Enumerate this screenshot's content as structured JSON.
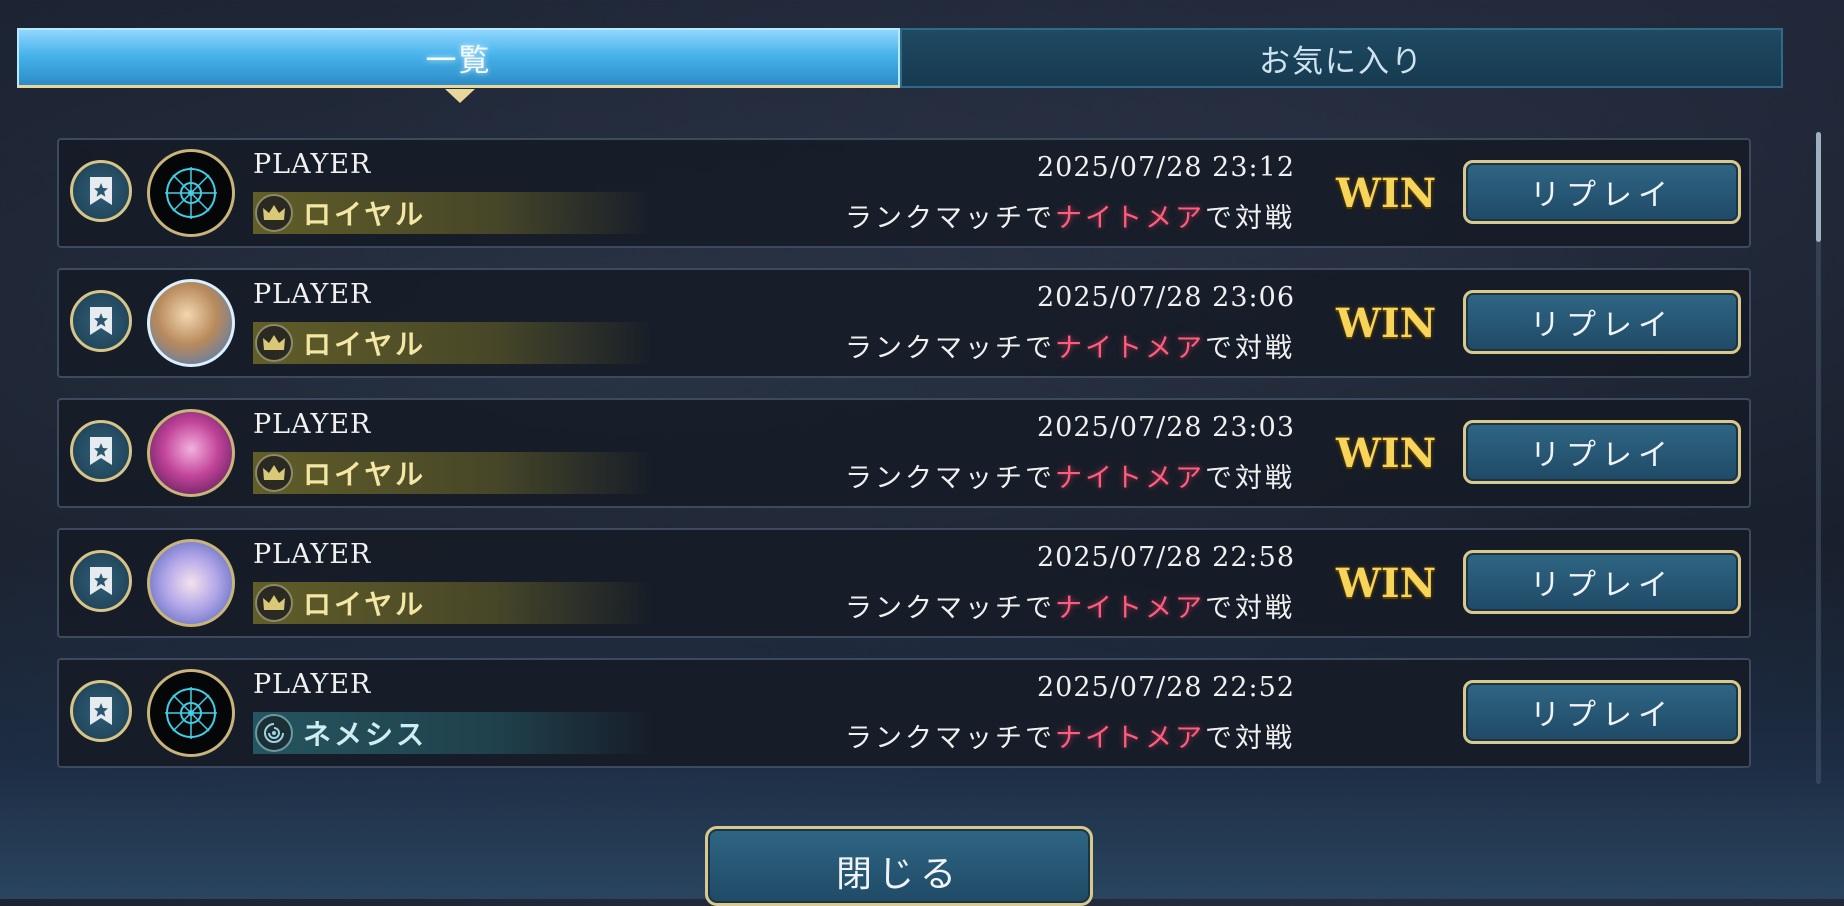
{
  "tabs": [
    {
      "label": "一覧",
      "active": true
    },
    {
      "label": "お気に入り",
      "active": false
    }
  ],
  "entries": [
    {
      "player": "PLAYER",
      "class_name": "ロイヤル",
      "class_icon": "crown-icon",
      "avatar": "emblem",
      "datetime": "2025/07/28 23:12",
      "desc_prefix": "ランクマッチで",
      "desc_highlight": "ナイトメア",
      "desc_suffix": "で対戦",
      "result": "WIN",
      "replay_label": "リプレイ"
    },
    {
      "player": "PLAYER",
      "class_name": "ロイヤル",
      "class_icon": "crown-icon",
      "avatar": "portrait-a",
      "datetime": "2025/07/28 23:06",
      "desc_prefix": "ランクマッチで",
      "desc_highlight": "ナイトメア",
      "desc_suffix": "で対戦",
      "result": "WIN",
      "replay_label": "リプレイ"
    },
    {
      "player": "PLAYER",
      "class_name": "ロイヤル",
      "class_icon": "crown-icon",
      "avatar": "portrait-b",
      "datetime": "2025/07/28 23:03",
      "desc_prefix": "ランクマッチで",
      "desc_highlight": "ナイトメア",
      "desc_suffix": "で対戦",
      "result": "WIN",
      "replay_label": "リプレイ"
    },
    {
      "player": "PLAYER",
      "class_name": "ロイヤル",
      "class_icon": "crown-icon",
      "avatar": "portrait-c",
      "datetime": "2025/07/28 22:58",
      "desc_prefix": "ランクマッチで",
      "desc_highlight": "ナイトメア",
      "desc_suffix": "で対戦",
      "result": "WIN",
      "replay_label": "リプレイ"
    },
    {
      "player": "PLAYER",
      "class_name": "ネメシス",
      "class_icon": "nemesis-icon",
      "avatar": "emblem",
      "datetime": "2025/07/28 22:52",
      "desc_prefix": "ランクマッチで",
      "desc_highlight": "ナイトメア",
      "desc_suffix": "で対戦",
      "result": "",
      "replay_label": "リプレイ"
    }
  ],
  "close_label": "閉じる",
  "colors": {
    "win": "#f7d45a",
    "highlight": "#ff5d7e",
    "button_border": "#d9c98e",
    "tab_active": "#48b3ea"
  }
}
